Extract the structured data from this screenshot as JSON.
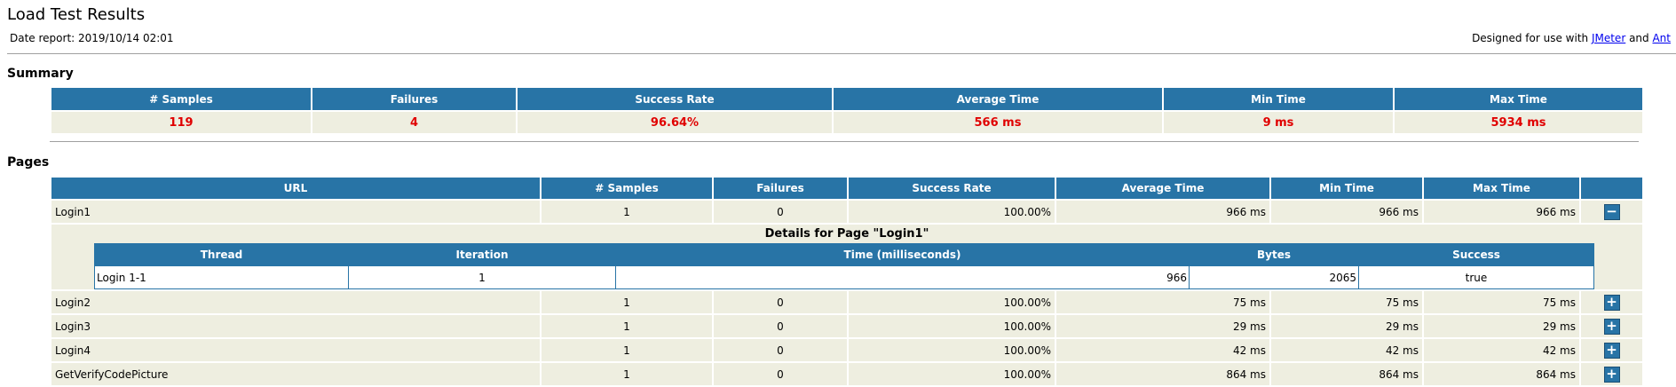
{
  "header": {
    "title": "Load Test Results",
    "date_report": "Date report: 2019/10/14 02:01",
    "designed_prefix": "Designed for use with ",
    "jmeter_link": "JMeter",
    "and_text": " and ",
    "ant_link": "Ant"
  },
  "summary": {
    "heading": "Summary",
    "columns": [
      "# Samples",
      "Failures",
      "Success Rate",
      "Average Time",
      "Min Time",
      "Max Time"
    ],
    "values": [
      "119",
      "4",
      "96.64%",
      "566 ms",
      "9 ms",
      "5934 ms"
    ]
  },
  "pages": {
    "heading": "Pages",
    "columns": [
      "URL",
      "# Samples",
      "Failures",
      "Success Rate",
      "Average Time",
      "Min Time",
      "Max Time"
    ],
    "rows": [
      {
        "url": "Login1",
        "samples": "1",
        "failures": "0",
        "rate": "100.00%",
        "avg": "966 ms",
        "min": "966 ms",
        "max": "966 ms",
        "toggle": "−"
      },
      {
        "url": "Login2",
        "samples": "1",
        "failures": "0",
        "rate": "100.00%",
        "avg": "75 ms",
        "min": "75 ms",
        "max": "75 ms",
        "toggle": "+"
      },
      {
        "url": "Login3",
        "samples": "1",
        "failures": "0",
        "rate": "100.00%",
        "avg": "29 ms",
        "min": "29 ms",
        "max": "29 ms",
        "toggle": "+"
      },
      {
        "url": "Login4",
        "samples": "1",
        "failures": "0",
        "rate": "100.00%",
        "avg": "42 ms",
        "min": "42 ms",
        "max": "42 ms",
        "toggle": "+"
      },
      {
        "url": "GetVerifyCodePicture",
        "samples": "1",
        "failures": "0",
        "rate": "100.00%",
        "avg": "864 ms",
        "min": "864 ms",
        "max": "864 ms",
        "toggle": "+"
      }
    ],
    "details": {
      "title": "Details for Page \"Login1\"",
      "columns": [
        "Thread",
        "Iteration",
        "Time (milliseconds)",
        "Bytes",
        "Success"
      ],
      "row": {
        "thread": "Login 1-1",
        "iteration": "1",
        "time": "966",
        "bytes": "2065",
        "success": "true"
      }
    }
  },
  "colors": {
    "header_bg": "#2874a6",
    "cell_bg": "#eeeee0",
    "summary_value": "#e00000"
  }
}
